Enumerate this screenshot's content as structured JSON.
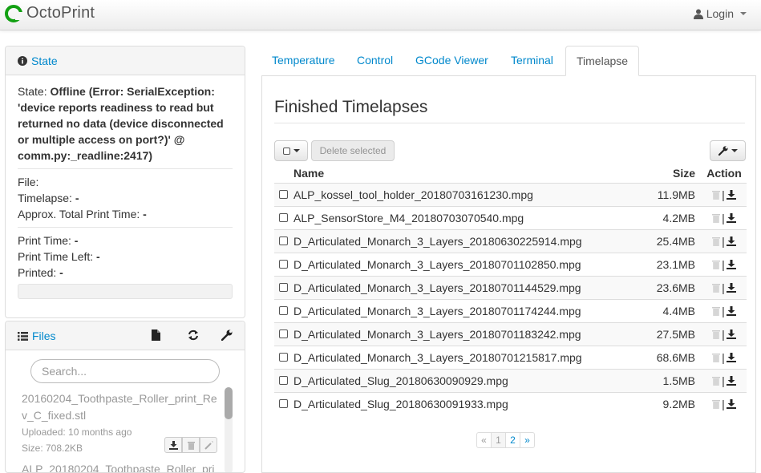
{
  "app": {
    "brand": "OctoPrint",
    "login_label": "Login"
  },
  "state_panel": {
    "title": "State",
    "state_label": "State:",
    "state_value": "Offline (Error: SerialException: 'device reports readiness to read but returned no data (device disconnected or multiple access on port?)' @ comm.py:_readline:2417)",
    "file_label": "File:",
    "file_value": "",
    "timelapse_label": "Timelapse:",
    "timelapse_value": "-",
    "approx_label": "Approx. Total Print Time:",
    "approx_value": "-",
    "print_time_label": "Print Time:",
    "print_time_value": "-",
    "print_left_label": "Print Time Left:",
    "print_left_value": "-",
    "printed_label": "Printed:",
    "printed_value": "-",
    "progress": 0
  },
  "files_panel": {
    "title": "Files",
    "search_placeholder": "Search...",
    "entry": {
      "name": "20160204_Toothpaste_Roller_print_Rev_C_fixed.stl",
      "uploaded": "Uploaded: 10 months ago",
      "size": "Size: 708.2KB"
    },
    "entry2_partial": "ALP_20180204_Toothpaste_Roller_pri"
  },
  "tabs": [
    {
      "label": "Temperature"
    },
    {
      "label": "Control"
    },
    {
      "label": "GCode Viewer"
    },
    {
      "label": "Terminal"
    },
    {
      "label": "Timelapse"
    }
  ],
  "timelapse": {
    "title": "Finished Timelapses",
    "delete_selected": "Delete selected",
    "col_name": "Name",
    "col_size": "Size",
    "col_action": "Action",
    "rows": [
      {
        "name": "ALP_kossel_tool_holder_20180703161230.mpg",
        "size": "11.9MB"
      },
      {
        "name": "ALP_SensorStore_M4_20180703070540.mpg",
        "size": "4.2MB"
      },
      {
        "name": "D_Articulated_Monarch_3_Layers_20180630225914.mpg",
        "size": "25.4MB"
      },
      {
        "name": "D_Articulated_Monarch_3_Layers_20180701102850.mpg",
        "size": "23.1MB"
      },
      {
        "name": "D_Articulated_Monarch_3_Layers_20180701144529.mpg",
        "size": "23.6MB"
      },
      {
        "name": "D_Articulated_Monarch_3_Layers_20180701174244.mpg",
        "size": "4.4MB"
      },
      {
        "name": "D_Articulated_Monarch_3_Layers_20180701183242.mpg",
        "size": "27.5MB"
      },
      {
        "name": "D_Articulated_Monarch_3_Layers_20180701215817.mpg",
        "size": "68.6MB"
      },
      {
        "name": "D_Articulated_Slug_20180630090929.mpg",
        "size": "1.5MB"
      },
      {
        "name": "D_Articulated_Slug_20180630091933.mpg",
        "size": "9.2MB"
      }
    ],
    "action_separator": "|",
    "pager": {
      "prev": "«",
      "pages": [
        "1",
        "2"
      ],
      "next": "»",
      "current": "1"
    }
  }
}
